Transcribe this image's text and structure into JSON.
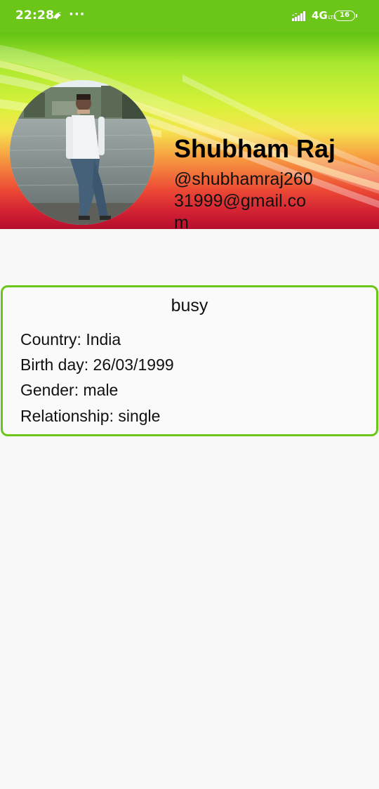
{
  "status_bar": {
    "time": "22:28",
    "notification_icon": "bird-notification-icon",
    "overflow": "···",
    "network": "4G",
    "network_sub": "LTE",
    "battery": "16"
  },
  "profile": {
    "name": "Shubham Raj",
    "email": "@shubhamraj26031999@gmail.com",
    "avatar": "profile-photo"
  },
  "info": {
    "status": "busy",
    "country": "Country: India",
    "birthday": "Birth day: 26/03/1999",
    "gender": "Gender: male",
    "relationship": "Relationship: single"
  },
  "colors": {
    "accent": "#6cc61a",
    "status_bar": "#6cc61a",
    "card_border": "#6cc61a"
  }
}
